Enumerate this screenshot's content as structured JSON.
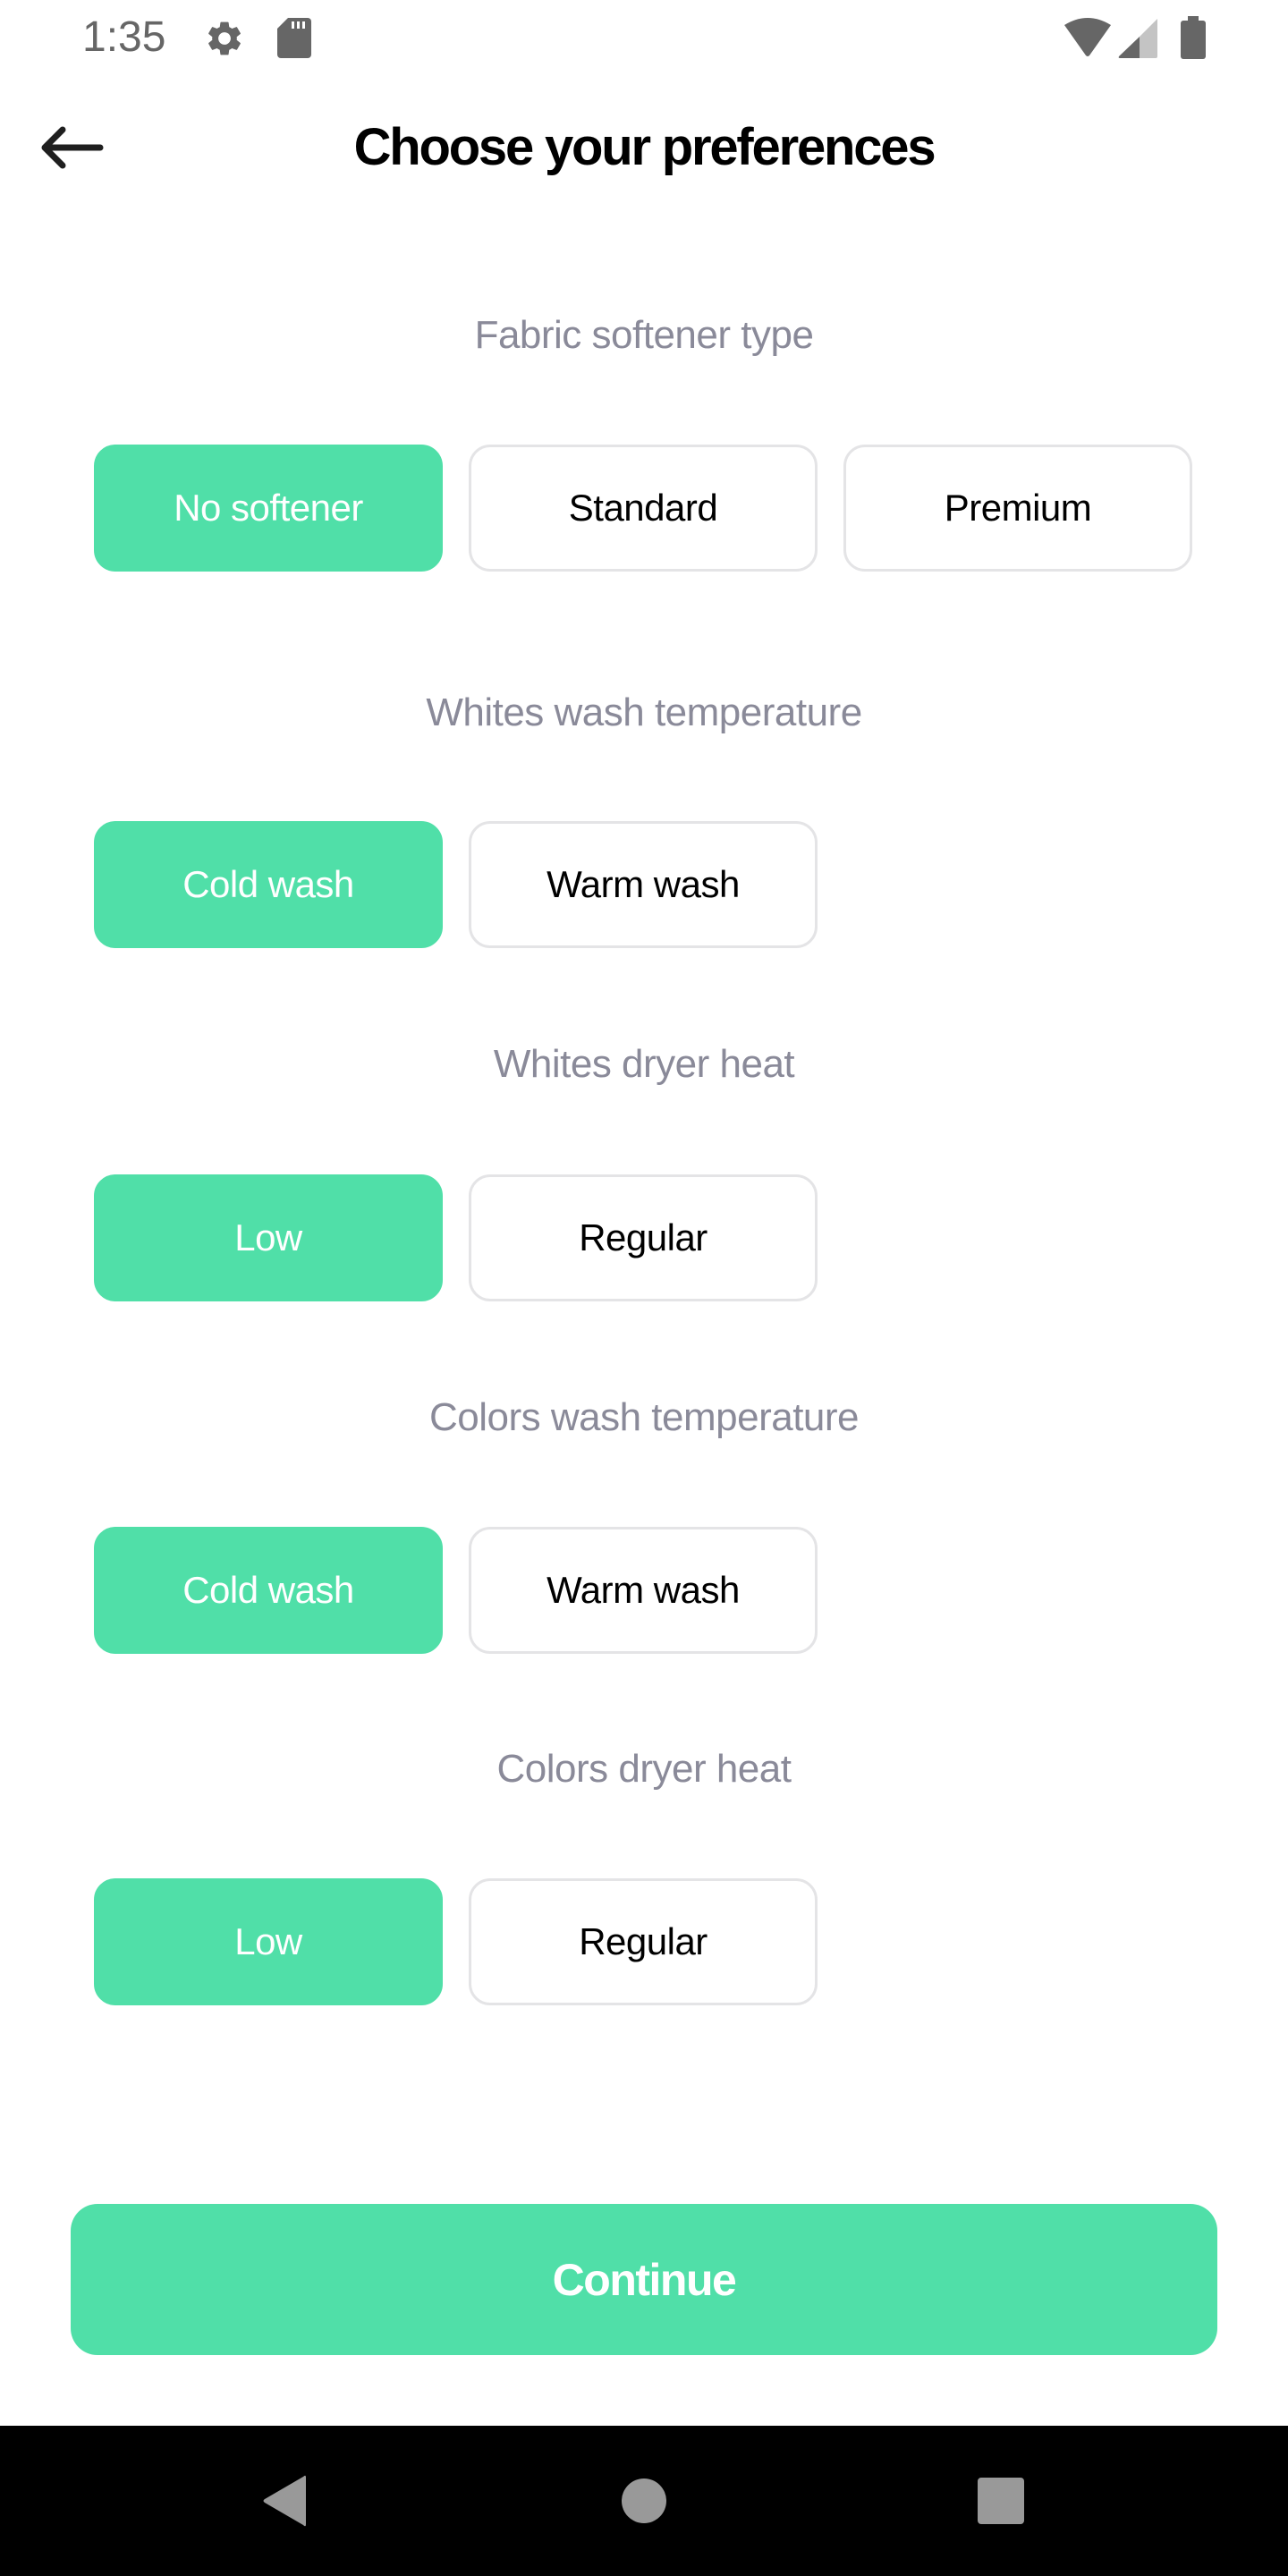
{
  "status_bar": {
    "time": "1:35",
    "left_icons": [
      "gear-icon",
      "sd-card-icon"
    ],
    "right_icons": [
      "wifi-icon",
      "cell-signal-icon",
      "battery-icon"
    ]
  },
  "header": {
    "back_icon": "arrow-left-icon",
    "title": "Choose your preferences"
  },
  "colors": {
    "accent": "#50DFA8",
    "label": "#8A8A99",
    "option_border": "#E4E4E6",
    "text": "#000000",
    "nav_bar": "#000000",
    "nav_icon": "#999999",
    "status_icon": "#666666"
  },
  "sections": [
    {
      "label": "Fabric softener type",
      "options": [
        "No softener",
        "Standard",
        "Premium"
      ],
      "selected": "No softener"
    },
    {
      "label": "Whites wash temperature",
      "options": [
        "Cold wash",
        "Warm wash"
      ],
      "selected": "Cold wash"
    },
    {
      "label": "Whites dryer heat",
      "options": [
        "Low",
        "Regular"
      ],
      "selected": "Low"
    },
    {
      "label": "Colors wash temperature",
      "options": [
        "Cold wash",
        "Warm wash"
      ],
      "selected": "Cold wash"
    },
    {
      "label": "Colors dryer heat",
      "options": [
        "Low",
        "Regular"
      ],
      "selected": "Low"
    }
  ],
  "footer": {
    "continue_label": "Continue"
  },
  "nav_bar": {
    "buttons": [
      "nav-back-icon",
      "nav-home-icon",
      "nav-recents-icon"
    ]
  }
}
